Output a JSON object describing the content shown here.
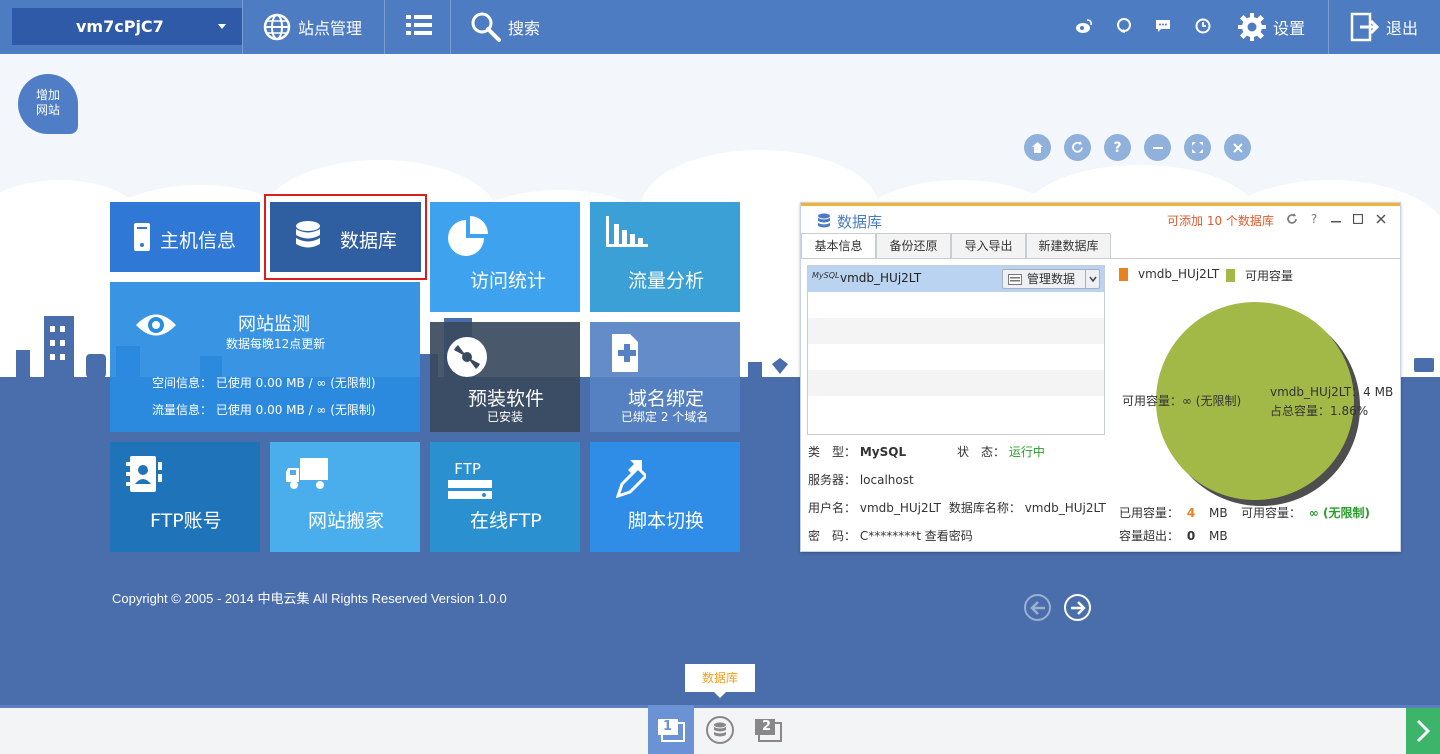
{
  "topbar": {
    "site_name": "vm7cPjC7",
    "site_manage": "站点管理",
    "search": "搜索",
    "settings": "设置",
    "logout": "退出"
  },
  "add_site": {
    "line1": "增加",
    "line2": "网站"
  },
  "tiles": {
    "host_info": "主机信息",
    "database": "数据库",
    "visit_stats": "访问统计",
    "traffic": "流量分析",
    "monitor": {
      "title": "网站监测",
      "subtitle": "数据每晚12点更新",
      "space": "空间信息： 已使用 0.00 MB / ∞ (无限制)",
      "flow": "流量信息： 已使用 0.00 MB / ∞ (无限制)"
    },
    "preinstall": {
      "title": "预装软件",
      "sub": "已安装"
    },
    "domain": {
      "title": "域名绑定",
      "sub": "已绑定 2 个域名"
    },
    "ftp_account": "FTP账号",
    "site_move": "网站搬家",
    "online_ftp": {
      "title": "在线FTP",
      "icon_text": "FTP"
    },
    "script_switch": "脚本切换"
  },
  "copyright": "Copyright © 2005 - 2014 中电云集 All Rights Reserved  Version 1.0.0",
  "panel": {
    "title": "数据库",
    "note": "可添加 10 个数据库",
    "help": "?",
    "tabs": [
      "基本信息",
      "备份还原",
      "导入导出",
      "新建数据库"
    ],
    "db_entry": "vmdb_HUj2LT",
    "mysql_logo": "MySQL",
    "manage_btn": "管理数据",
    "type_label": "类　型：",
    "type_value": "MySQL",
    "status_label": "状　态：",
    "status_value": "运行中",
    "server_label": "服务器：",
    "server_value": "localhost",
    "user_label": "用户名：",
    "user_value": "vmdb_HUj2LT",
    "dbname_label": "数据库名称：",
    "dbname_value": "vmdb_HUj2LT",
    "pwd_label": "密　码：",
    "pwd_value": "C********t",
    "pwd_link": "查看密码",
    "legend": [
      "vmdb_HUj2LT",
      "可用容量"
    ],
    "pie_left": "可用容量：∞ (无限制)",
    "pie_right1": "vmdb_HUj2LT：4 MB",
    "pie_right2": "占总容量：1.86%",
    "used_label": "已用容量：",
    "used_value": "4",
    "used_unit": "MB",
    "avail_label": "可用容量：",
    "avail_value": "∞ (无限制)",
    "over_label": "容量超出：",
    "over_value": "0",
    "over_unit": "MB"
  },
  "bottom": {
    "tooltip": "数据库",
    "page1": "1",
    "page2": "2"
  },
  "colors": {
    "topbar": "#4e7cc3",
    "band": "#4a6eac",
    "pie_available": "#a3b947",
    "legend_db": "#e8821e",
    "status_green": "#2a9d2a"
  }
}
